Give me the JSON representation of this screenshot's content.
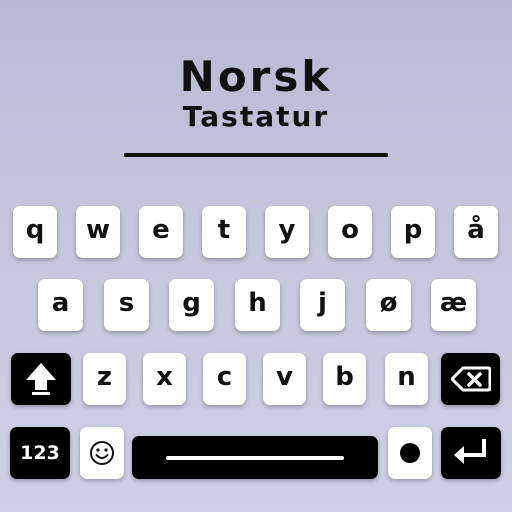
{
  "header": {
    "title": "Norsk",
    "subtitle": "Tastatur"
  },
  "keyboard": {
    "row1": [
      "q",
      "w",
      "e",
      "t",
      "y",
      "o",
      "p",
      "å"
    ],
    "row2": [
      "a",
      "s",
      "g",
      "h",
      "j",
      "ø",
      "æ"
    ],
    "row3": [
      "z",
      "x",
      "c",
      "v",
      "b",
      "n"
    ],
    "numbers_key": "123",
    "icons": {
      "shift": "shift-arrow-icon",
      "backspace": "backspace-icon",
      "emoji": "smiley-icon",
      "enter": "enter-return-icon"
    }
  },
  "colors": {
    "background_top": "#b9b9d4",
    "background_bottom": "#cfcfe5",
    "key_light": "#ffffff",
    "key_dark": "#000000",
    "text": "#111111"
  }
}
